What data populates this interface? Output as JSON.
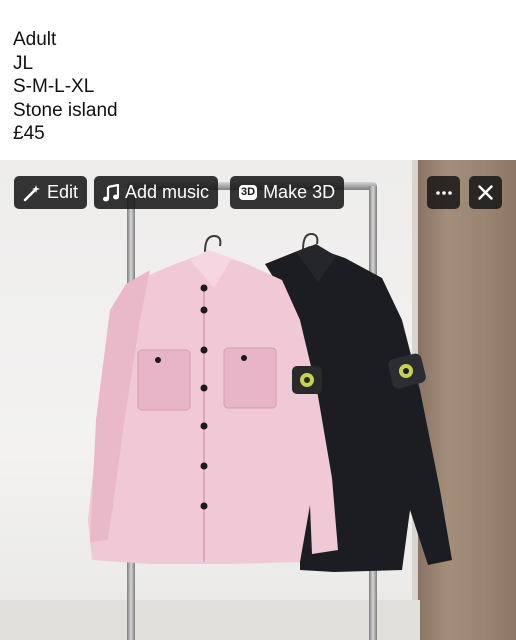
{
  "post": {
    "lines": [
      "Adult",
      "JL",
      "S-M-L-XL",
      "Stone island",
      "£45"
    ]
  },
  "toolbar": {
    "edit_label": "Edit",
    "add_music_label": "Add music",
    "make_3d_label": "Make 3D",
    "badge_3d": "3D"
  },
  "colors": {
    "button_bg": "#191919",
    "pink_shirt": "#f1c8d6",
    "black_shirt": "#1c1d22",
    "badge_green": "#c8d24a"
  },
  "icons": {
    "edit": "magic-wand-icon",
    "add_music": "music-note-icon",
    "make_3d": "3d-badge-icon",
    "more": "more-icon",
    "close": "close-icon"
  }
}
